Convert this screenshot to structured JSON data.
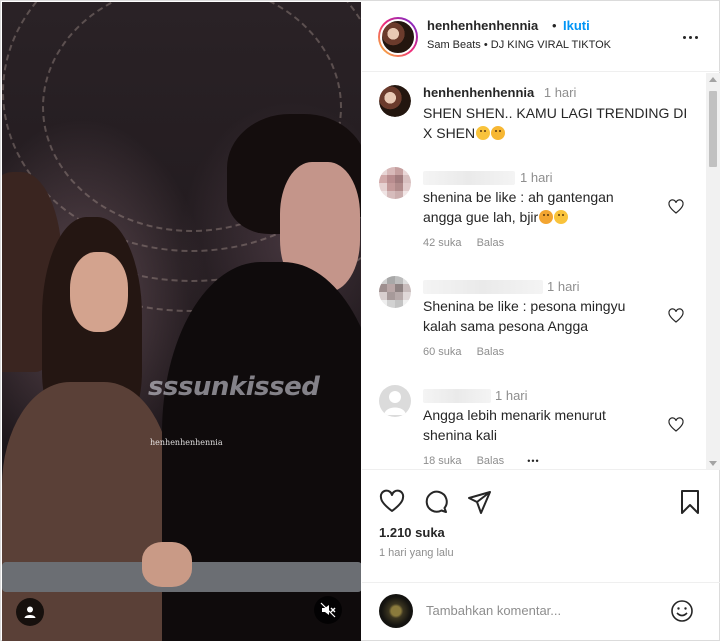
{
  "media": {
    "watermark": "sssunkissed",
    "small_watermark": "henhenhenhennia",
    "icons": {
      "user_tag": "user-icon",
      "mute": "speaker-muted-icon"
    }
  },
  "header": {
    "username": "henhenhenhennia",
    "separator": "•",
    "follow_label": "Ikuti",
    "audio_artist": "Sam Beats",
    "audio_sep": "•",
    "audio_track": "DJ KING VIRAL TIKTOK"
  },
  "caption": {
    "username": "henhenhenhennia",
    "time": "1 hari",
    "text_line1": "SHEN SHEN.. KAMU LAGI TRENDING DI",
    "text_line2": "X SHEN"
  },
  "comments": [
    {
      "time": "1 hari",
      "line1": "shenina be like : ah gantengan",
      "line2": "angga gue lah, bjir",
      "likes": "42 suka",
      "reply": "Balas"
    },
    {
      "time": "1 hari",
      "line1": "Shenina be like : pesona mingyu",
      "line2": "kalah sama pesona Angga",
      "likes": "60 suka",
      "reply": "Balas"
    },
    {
      "time": "1 hari",
      "line1": "Angga lebih menarik menurut",
      "line2": "shenina kali",
      "likes": "18 suka",
      "reply": "Balas",
      "more": "•••"
    }
  ],
  "actions": {
    "likes": "1.210 suka",
    "date": "1 hari yang lalu",
    "icons": [
      "heart-icon",
      "comment-icon",
      "share-icon",
      "bookmark-icon"
    ]
  },
  "add_comment": {
    "placeholder": "Tambahkan komentar..."
  },
  "colors": {
    "link_blue": "#0095f6",
    "text": "#262626",
    "muted": "#8e8e8e"
  }
}
